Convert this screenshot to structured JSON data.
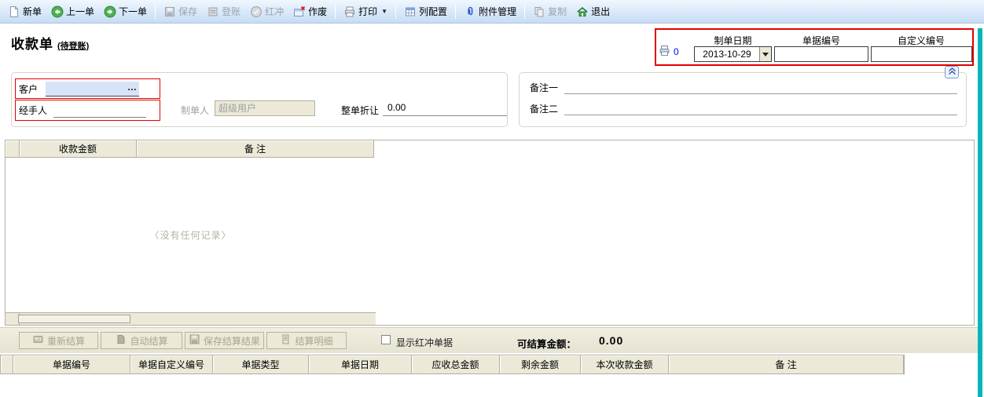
{
  "toolbar": {
    "items": [
      {
        "label": "新单",
        "enabled": true
      },
      {
        "label": "上一单",
        "enabled": true
      },
      {
        "label": "下一单",
        "enabled": true
      },
      {
        "label": "保存",
        "enabled": false
      },
      {
        "label": "登账",
        "enabled": false
      },
      {
        "label": "红冲",
        "enabled": false
      },
      {
        "label": "作废",
        "enabled": true
      },
      {
        "label": "打印",
        "enabled": true
      },
      {
        "label": "列配置",
        "enabled": true
      },
      {
        "label": "附件管理",
        "enabled": true
      },
      {
        "label": "复制",
        "enabled": false
      },
      {
        "label": "退出",
        "enabled": true
      }
    ]
  },
  "header": {
    "title": "收款单",
    "status": "(待登账)",
    "print_count": "0",
    "fields": [
      {
        "label": "制单日期",
        "value": "2013-10-29"
      },
      {
        "label": "单据编号",
        "value": ""
      },
      {
        "label": "自定义编号",
        "value": ""
      }
    ]
  },
  "form": {
    "customer_label": "客户",
    "customer_value": "",
    "lookup_label": "…",
    "handler_label": "经手人",
    "handler_value": "",
    "creator_label": "制单人",
    "creator_value": "超级用户",
    "discount_label": "整单折让",
    "discount_value": "0.00",
    "remark1_label": "备注一",
    "remark1_value": "",
    "remark2_label": "备注二",
    "remark2_value": ""
  },
  "detail_table": {
    "columns": [
      "收款金额",
      "备 注"
    ],
    "empty_text": "〈没有任何记录〉"
  },
  "settlement": {
    "buttons": [
      {
        "label": "重新结算"
      },
      {
        "label": "自动结算"
      },
      {
        "label": "保存结算结果"
      },
      {
        "label": "结算明细"
      }
    ],
    "show_red_label": "显示红冲单据",
    "amount_label": "可结算金额：",
    "amount_value": "0.00"
  },
  "documents_table": {
    "columns": [
      "单据编号",
      "单据自定义编号",
      "单据类型",
      "单据日期",
      "应收总金额",
      "剩余金额",
      "本次收款金额",
      "备 注"
    ]
  },
  "colors": {
    "accent_red": "#e10000",
    "teal_edge": "#00b6ba",
    "panel_beige": "#ece9d8",
    "input_highlight": "#d9e3f8",
    "toolbar_blue": "#dcebfa"
  }
}
